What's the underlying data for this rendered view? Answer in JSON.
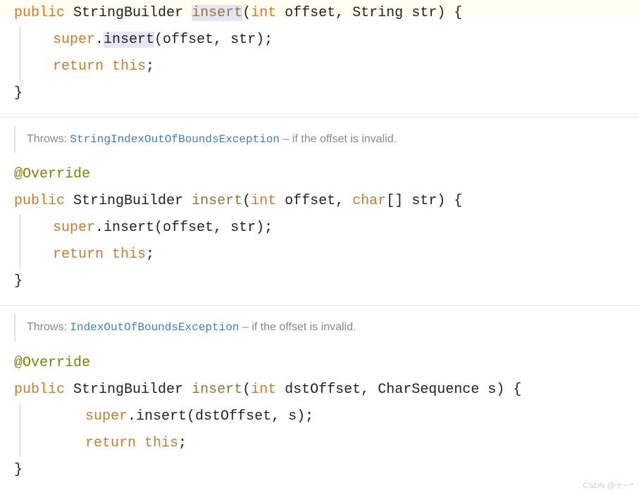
{
  "methods": [
    {
      "sig": {
        "modifier": "public",
        "returnType": "StringBuilder",
        "name": "insert",
        "p1type": "int",
        "p1name": "offset",
        "p2type": "String",
        "p2name": "str"
      },
      "body": {
        "superCall": "super",
        "superMethod": "insert",
        "superArgs": "(offset, str)",
        "ret": "return",
        "retThis": "this"
      }
    },
    {
      "throws": {
        "label": "Throws:",
        "exception": "StringIndexOutOfBoundsException",
        "desc": " – if the offset is invalid."
      },
      "annotation": "@Override",
      "sig": {
        "modifier": "public",
        "returnType": "StringBuilder",
        "name": "insert",
        "p1type": "int",
        "p1name": "offset",
        "p2type": "char",
        "p2brackets": "[]",
        "p2name": "str"
      },
      "body": {
        "superCall": "super",
        "superMethod": "insert",
        "superArgs": "(offset, str)",
        "ret": "return",
        "retThis": "this"
      }
    },
    {
      "throws": {
        "label": "Throws:",
        "exception": "IndexOutOfBoundsException",
        "desc": " – if the offset is invalid."
      },
      "annotation": "@Override",
      "sig": {
        "modifier": "public",
        "returnType": "StringBuilder",
        "name": "insert",
        "p1type": "int",
        "p1name": "dstOffset",
        "p2type": "CharSequence",
        "p2name": "s"
      },
      "body": {
        "superCall": "super",
        "superMethod": "insert",
        "superArgs": "(dstOffset, s)",
        "ret": "return",
        "retThis": "this"
      }
    }
  ],
  "watermark": "CSDN @十一*"
}
